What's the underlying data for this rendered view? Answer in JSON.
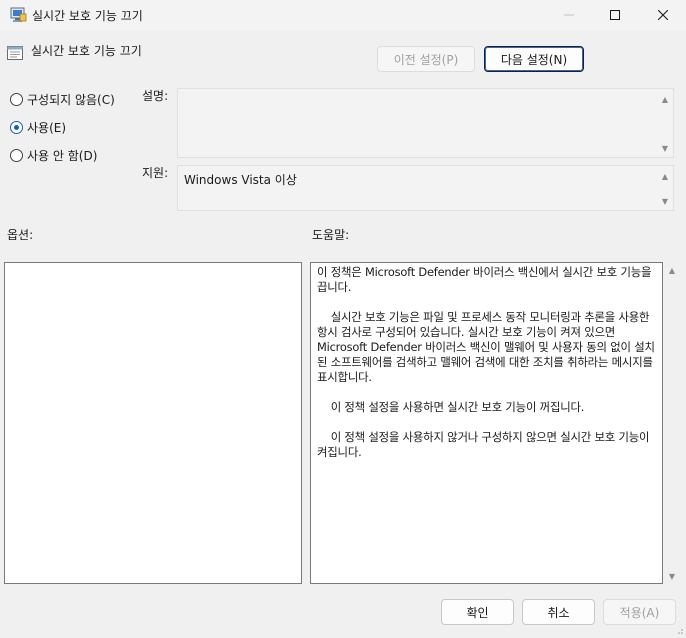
{
  "window": {
    "title": "실시간 보호 기능 끄기"
  },
  "header": {
    "title": "실시간 보호 기능 끄기",
    "prev_button": "이전 설정(P)",
    "next_button": "다음 설정(N)"
  },
  "radios": [
    {
      "label": "구성되지 않음(C)",
      "checked": false
    },
    {
      "label": "사용(E)",
      "checked": true
    },
    {
      "label": "사용 안 함(D)",
      "checked": false
    }
  ],
  "labels": {
    "description": "설명:",
    "supported_on": "지원:",
    "options": "옵션:",
    "help": "도움말:"
  },
  "supported_on_value": "Windows Vista 이상",
  "help_text": [
    "이 정책은 Microsoft Defender 바이러스 백신에서 실시간 보호 기능을 끕니다.",
    "    실시간 보호 기능은 파일 및 프로세스 동작 모니터링과 추론을 사용한 항시 검사로 구성되어 있습니다. 실시간 보호 기능이 켜져 있으면 Microsoft Defender 바이러스 백신이 맬웨어 및 사용자 동의 없이 설치된 소프트웨어를 검색하고 맬웨어 검색에 대한 조치를 취하라는 메시지를 표시합니다.",
    "    이 정책 설정을 사용하면 실시간 보호 기능이 꺼집니다.",
    "    이 정책 설정을 사용하지 않거나 구성하지 않으면 실시간 보호 기능이 켜집니다."
  ],
  "footer": {
    "ok": "확인",
    "cancel": "취소",
    "apply": "적용(A)"
  },
  "icons": {
    "app": "group-policy-icon",
    "setting": "policy-setting-icon"
  }
}
